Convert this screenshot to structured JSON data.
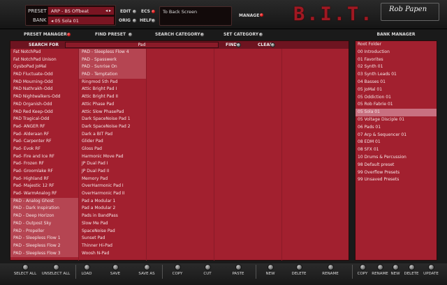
{
  "header": {
    "preset_label": "PRESET",
    "preset_value": "ARP - BS Offbeat",
    "bank_label": "BANK",
    "bank_value": "05 Sola 01",
    "arrows_preset": "◂ ▸",
    "arrow_left": "◂",
    "edit": "EDIT",
    "ecs": "ECS",
    "orig": "ORIG",
    "help": "HELP",
    "back_to_screen": "To Back Screen",
    "manager": "MANAGER",
    "logo": "B.I.T.",
    "brand": "Rob Papen"
  },
  "toolbar": {
    "preset_manager": "PRESET MANAGER",
    "find_preset": "FIND PRESET",
    "search_category": "SEARCH CATEGORY",
    "set_category": "SET CATEGORY",
    "bank_manager": "BANK MANAGER"
  },
  "search": {
    "label": "SEARCH FOR",
    "value": "Pad",
    "find": "FIND",
    "clear": "CLEAR"
  },
  "columns": {
    "col1": [
      "Fat NotchPad",
      "Fat NotchPad Unison",
      "GysboPad JoMal",
      "PAD Fluctuate-Odd",
      "PAD Mourning-Odd",
      "PAD Nathrakh-Odd",
      "PAD Nightwalkers-Odd",
      "PAD Organish-Odd",
      "PAD Red Keep-Odd",
      "PAD Tragical-Odd",
      "Pad- ANGER RF",
      "Pad- Alderaan RF",
      "Pad- Carpenter RF",
      "Pad- Evok RF",
      "Pad- Fire and Ice RF",
      "Pad- Frozen RF",
      "Pad- Groomlake RF",
      "Pad- Highland RF",
      "Pad- Majestic 12 RF",
      "Pad- WarmAnalog RF",
      "PAD - Analog Ghost",
      "PAD - Dark Inspiration",
      "PAD - Deep Horizon",
      "PAD - Outpost Sky",
      "PAD - Propeller",
      "PAD - Sleepless Flow 1",
      "PAD - Sleepless Flow 2",
      "PAD - Sleepless Flow 3"
    ],
    "col2": [
      "PAD - Sleepless Flow 4",
      "PAD - Spasswerk",
      "PAD - Sunrise On",
      "PAD - Temptation",
      "Ringmod 5th Pad",
      "Attic Bright Pad I",
      "Attic Bright Pad II",
      "Attic Phase Pad",
      "Attic Slow PhasePad",
      "Dark SpaceNoise Pad 1",
      "Dark SpaceNoise Pad 2",
      "Dark a BIT Pad",
      "Glider Pad",
      "Gloss Pad",
      "Harmonic Move Pad",
      "JP Dual Pad I",
      "JP Dual Pad II",
      "Memory Pad",
      "OverHarmonic Pad I",
      "OverHarmonic Pad II",
      "Pad a Modular 1",
      "Pad a Modular 2",
      "Pads in BandPass",
      "Slow Me Pad",
      "SpaceNoise Pad",
      "Sunset Pad",
      "Thinner Hi-Pad",
      "Woosh N-Pad"
    ]
  },
  "bank": {
    "items": [
      "Root Folder",
      "00 Introduction",
      "01 Favorites",
      "02 Synth 01",
      "03 Synth Leads 01",
      "04 Basses 01",
      "05 JoMal 01",
      "05 Oddiction 01",
      "05 Rob Fabrie 01",
      "05 Sola 01",
      "05 Voltage Disciple 01",
      "06 Pads 01",
      "07 Arp & Sequencer 01",
      "08 EDM 01",
      "08 SFX 01",
      "10 Drums & Percussion",
      "98 Default preset",
      "99 Overflow Presets",
      "99 Unsaved Presets"
    ],
    "selected_index": 9
  },
  "bottom": {
    "select_all": "SELECT ALL",
    "unselect_all": "UNSELECT ALL",
    "load": "LOAD",
    "save": "SAVE",
    "save_as": "SAVE AS",
    "copy": "COPY",
    "cut": "CUT",
    "paste": "PASTE",
    "new": "NEW",
    "delete": "DELETE",
    "rename": "RENAME",
    "b_copy": "COPY",
    "b_rename": "RENAME",
    "b_new": "NEW",
    "b_delete": "DELETE",
    "b_update": "UPDATE"
  },
  "colors": {
    "accent": "#a2202f",
    "highlight": "#b54552",
    "selected": "#c87080",
    "led": "#d01010"
  }
}
